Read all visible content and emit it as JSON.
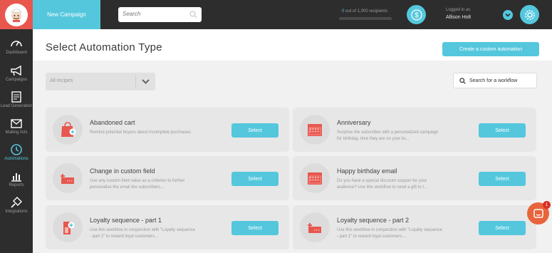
{
  "topbar": {
    "new_campaign": "New Campaign",
    "search_placeholder": "Search",
    "recipients_used": "0",
    "recipients_rest": " out of 1,000 recipients",
    "recipients_progress": 0,
    "logged_in_label": "Logged in as",
    "user_name": "Allison Holt"
  },
  "sidebar": {
    "items": [
      {
        "label": "Dashboard",
        "icon": "gauge-icon"
      },
      {
        "label": "Campaigns",
        "icon": "megaphone-icon"
      },
      {
        "label": "Lead Generation",
        "icon": "form-icon"
      },
      {
        "label": "Mailing lists",
        "icon": "envelope-icon"
      },
      {
        "label": "Automations",
        "icon": "clock-icon",
        "active": true
      },
      {
        "label": "Reports",
        "icon": "bar-chart-icon"
      },
      {
        "label": "Integrations",
        "icon": "plug-icon"
      }
    ]
  },
  "header": {
    "title": "Select Automation Type",
    "custom_button": "Create a custom automation"
  },
  "filters": {
    "recipe_value": "All recipes",
    "search_label": "Search for a workflow"
  },
  "cards": [
    {
      "title": "Abandoned cart",
      "desc": "Remind potential buyers about incomplete purchases.",
      "button": "Select",
      "icon": "shopping-bag-plus-icon"
    },
    {
      "title": "Anniversary",
      "desc": "Surprise the subscriber with a personalized campaign for birthday, time they are on your lis...",
      "button": "Select",
      "icon": "calendar-icon"
    },
    {
      "title": "Change in custom field",
      "desc": "Use any custom field value as a criterion to further personalize the email the subscribers...",
      "button": "Select",
      "icon": "custom-field-icon"
    },
    {
      "title": "Happy birthday email",
      "desc": "Do you have a special discount coupon for your audience? Use this workflow to send a gift to t...",
      "button": "Select",
      "icon": "calendar-icon"
    },
    {
      "title": "Loyalty sequence - part 1",
      "desc": "Use this workflow in conjunction with \"Loyalty sequence - part 2\" to reward loyal customers...",
      "button": "Select",
      "icon": "loyalty-tag-plus-icon"
    },
    {
      "title": "Loyalty sequence - part 2",
      "desc": "Use this workflow in conjunction with \"Loyalty sequence - part 1\" to reward loyal customers,...",
      "button": "Select",
      "icon": "custom-field-icon"
    }
  ],
  "chat": {
    "badge": "1"
  },
  "colors": {
    "accent": "#54c7dd",
    "brand_red": "#e8574e",
    "sidebar": "#2d2d2d",
    "chat": "#e8643c"
  }
}
